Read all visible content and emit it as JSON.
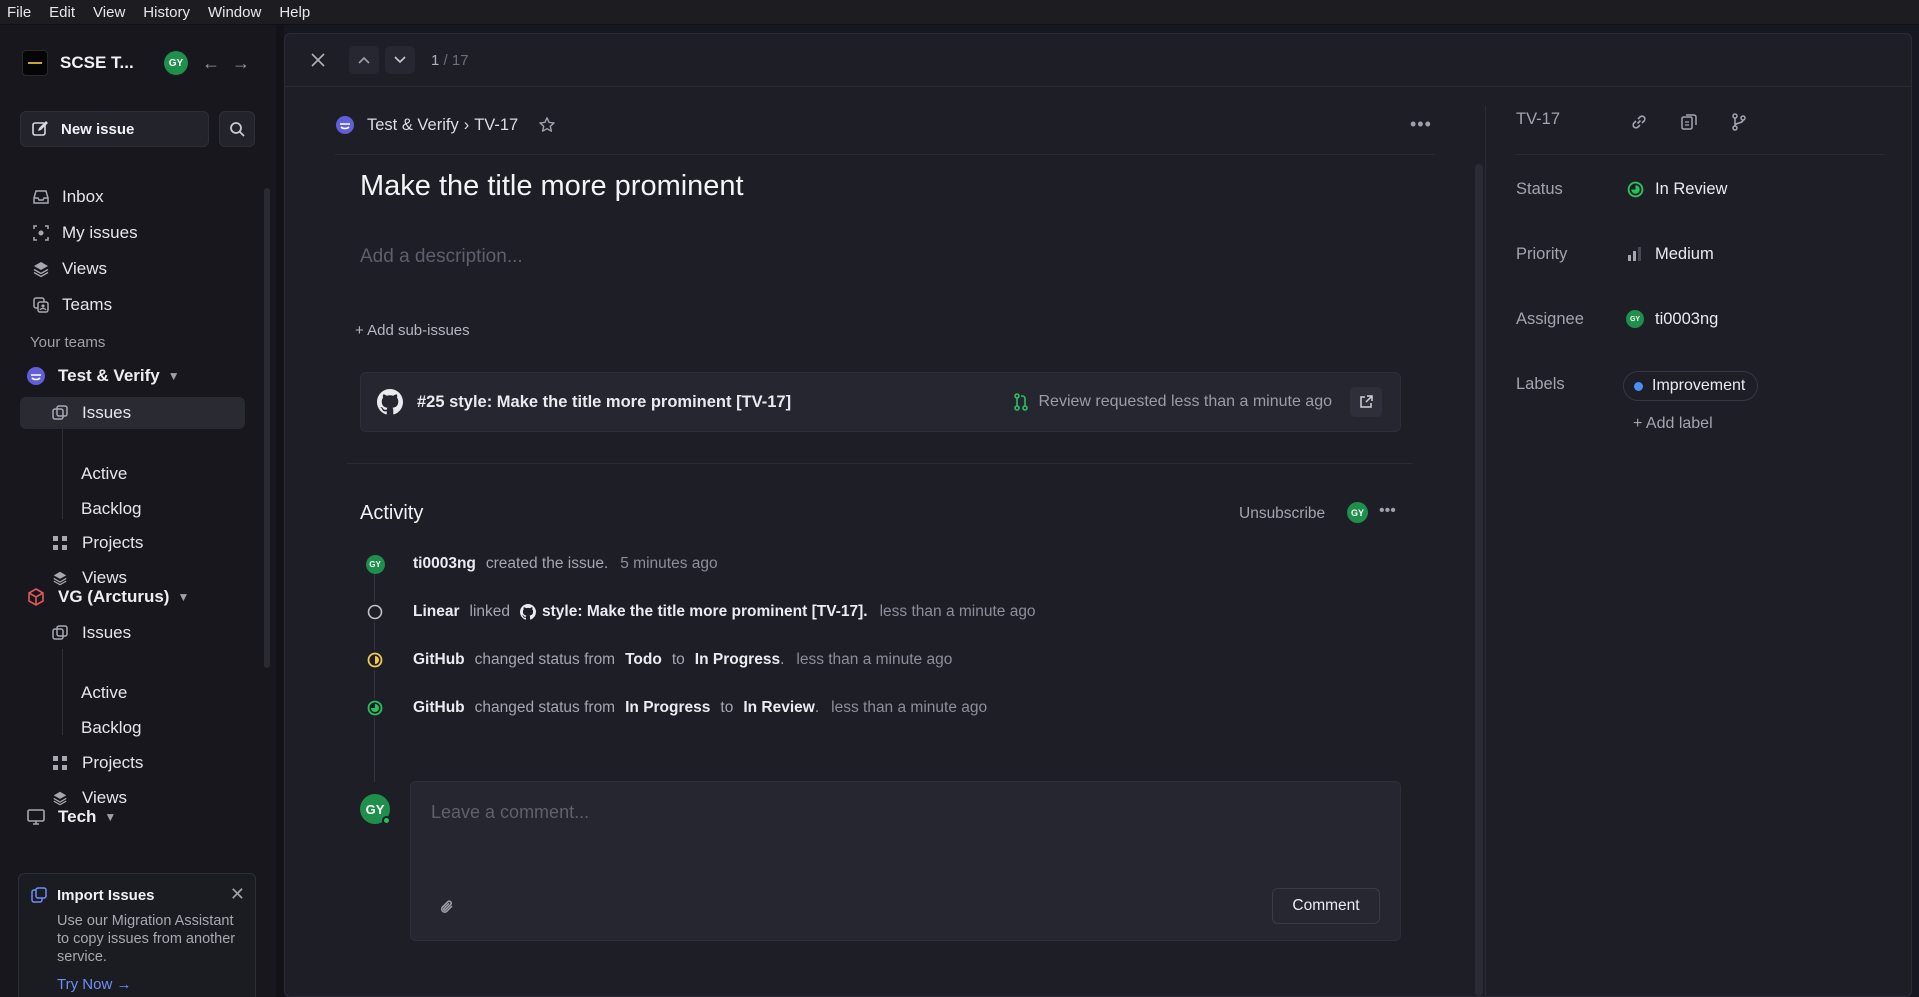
{
  "menu": [
    "File",
    "Edit",
    "View",
    "History",
    "Window",
    "Help"
  ],
  "workspace": {
    "name": "SCSE T...",
    "user_initials": "GY"
  },
  "sidebar": {
    "new_issue": "New issue",
    "nav": [
      "Inbox",
      "My issues",
      "Views",
      "Teams"
    ],
    "your_teams": "Your teams",
    "teams": [
      {
        "name": "Test & Verify",
        "items": [
          "Issues",
          "Active",
          "Backlog",
          "Projects",
          "Views"
        ]
      },
      {
        "name": "VG (Arcturus)",
        "items": [
          "Issues",
          "Active",
          "Backlog",
          "Projects",
          "Views"
        ]
      },
      {
        "name": "Tech"
      }
    ],
    "import_card": {
      "title": "Import Issues",
      "body": "Use our Migration Assistant to copy issues from another service.",
      "link": "Try Now →"
    }
  },
  "topbar": {
    "position": "1",
    "total": "/ 17"
  },
  "issue": {
    "team": "Test & Verify",
    "separator": "›",
    "id": "TV-17",
    "title": "Make the title more prominent",
    "description_placeholder": "Add a description...",
    "add_sub_issues": "+ Add sub-issues",
    "pr": {
      "title": "#25 style: Make the title more prominent [TV-17]",
      "status": "Review requested less than a minute ago"
    }
  },
  "activity": {
    "title": "Activity",
    "unsubscribe": "Unsubscribe",
    "events": [
      {
        "actor": "ti0003ng",
        "text": "created the issue.",
        "time": "5 minutes ago"
      },
      {
        "actor": "Linear",
        "text": "linked",
        "target": "style: Make the title more prominent [TV-17].",
        "time": "less than a minute ago"
      },
      {
        "actor": "GitHub",
        "text": "changed status from",
        "from": "Todo",
        "to_word": "to",
        "to": "In Progress",
        "time": "less than a minute ago"
      },
      {
        "actor": "GitHub",
        "text": "changed status from",
        "from": "In Progress",
        "to_word": "to",
        "to": "In Review",
        "time": "less than a minute ago"
      }
    ],
    "comment_placeholder": "Leave a comment...",
    "comment_button": "Comment"
  },
  "properties": {
    "id": "TV-17",
    "status_label": "Status",
    "status": "In Review",
    "priority_label": "Priority",
    "priority": "Medium",
    "assignee_label": "Assignee",
    "assignee": "ti0003ng",
    "labels_label": "Labels",
    "label": "Improvement",
    "add_label": "+ Add label"
  },
  "colors": {
    "accent_green": "#27c15e",
    "in_progress": "#f2c94c",
    "label_blue": "#4b8ef5",
    "link": "#6e8ef5"
  }
}
